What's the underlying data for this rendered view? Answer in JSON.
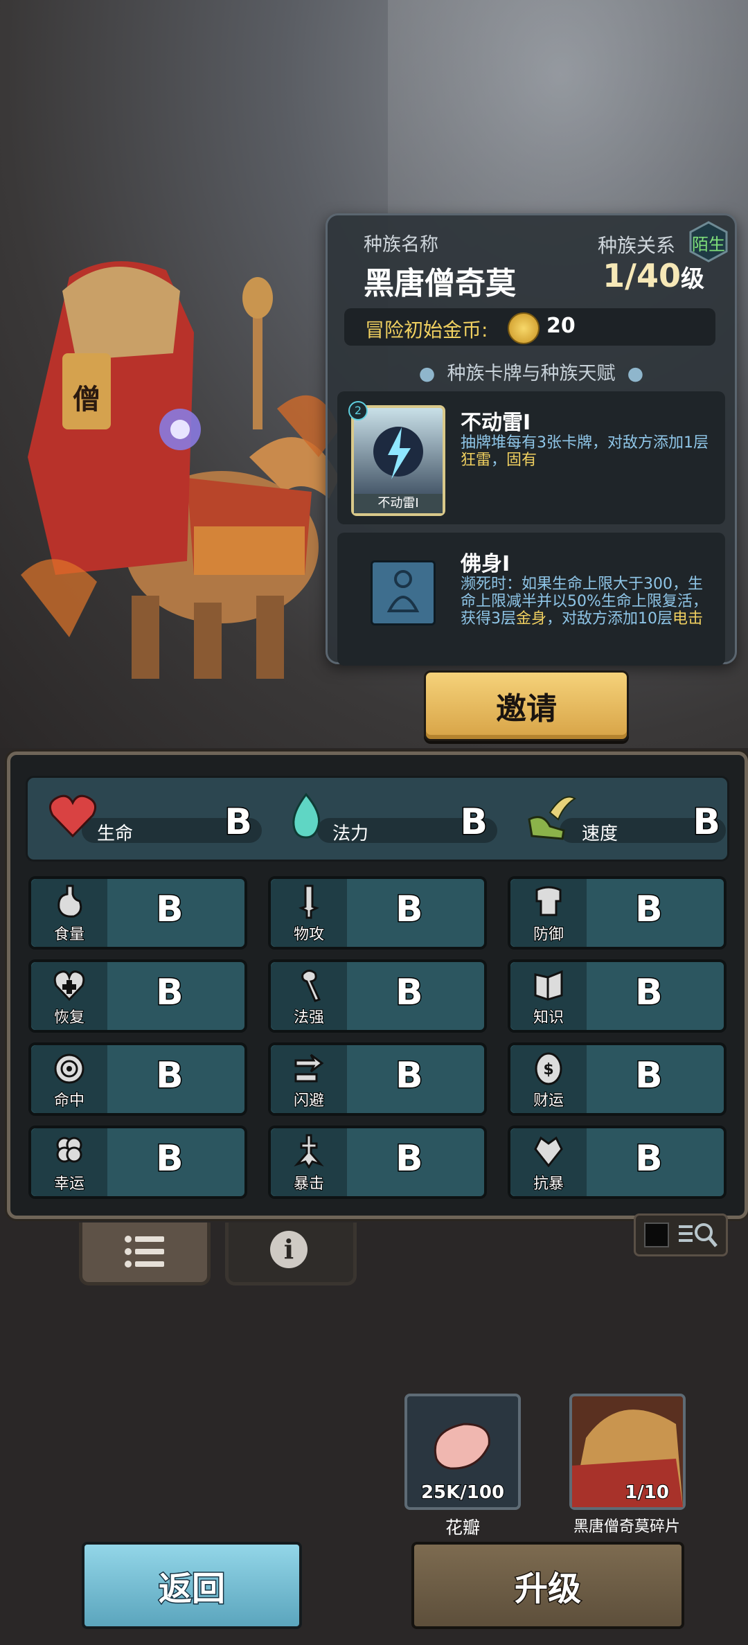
{
  "race_panel": {
    "name_label": "种族名称",
    "relation_label": "种族关系",
    "relation_badge": "陌生",
    "race_name": "黑唐僧奇莫",
    "level": "1/40",
    "level_unit": "级",
    "gold_label": "冒险初始金币:",
    "gold_value": "20",
    "section_title": "种族卡牌与种族天赋",
    "card": {
      "cost": "2",
      "art_label": "不动雷I",
      "name": "不动雷I",
      "desc_a": "抽牌堆每有3张卡牌，对敌方添加1层",
      "desc_hl1": "狂雷",
      "desc_b": "，",
      "desc_hl2": "固有"
    },
    "talent": {
      "name": "佛身I",
      "desc_a": "濒死时：如果生命上限大于300，生命上限减半并以50%生命上限复活，获得3层",
      "desc_hl1": "金身",
      "desc_b": "，对敌方添加10层",
      "desc_hl2": "电击"
    }
  },
  "invite_label": "邀请",
  "top_stats": [
    {
      "label": "生命",
      "grade": "B",
      "icon": "heart-icon",
      "color": "#d94242"
    },
    {
      "label": "法力",
      "grade": "B",
      "icon": "mana-flame-icon",
      "color": "#5fd6c4"
    },
    {
      "label": "速度",
      "grade": "B",
      "icon": "winged-boot-icon",
      "color": "#8bb24a"
    }
  ],
  "stats": [
    {
      "label": "食量",
      "grade": "B",
      "icon": "stomach-icon"
    },
    {
      "label": "物攻",
      "grade": "B",
      "icon": "sword-icon"
    },
    {
      "label": "防御",
      "grade": "B",
      "icon": "armor-icon"
    },
    {
      "label": "恢复",
      "grade": "B",
      "icon": "heal-heart-icon"
    },
    {
      "label": "法强",
      "grade": "B",
      "icon": "staff-icon"
    },
    {
      "label": "知识",
      "grade": "B",
      "icon": "book-icon"
    },
    {
      "label": "命中",
      "grade": "B",
      "icon": "target-icon"
    },
    {
      "label": "闪避",
      "grade": "B",
      "icon": "dodge-icon"
    },
    {
      "label": "财运",
      "grade": "B",
      "icon": "coin-icon"
    },
    {
      "label": "幸运",
      "grade": "B",
      "icon": "clover-icon"
    },
    {
      "label": "暴击",
      "grade": "B",
      "icon": "crit-icon"
    },
    {
      "label": "抗暴",
      "grade": "B",
      "icon": "crit-resist-icon"
    }
  ],
  "resources": [
    {
      "label": "花瓣",
      "count": "25K/100",
      "icon": "petal-icon"
    },
    {
      "label": "黑唐僧奇莫碎片",
      "count": "1/10",
      "icon": "character-shard-icon"
    }
  ],
  "back_label": "返回",
  "upgrade_label": "升级"
}
